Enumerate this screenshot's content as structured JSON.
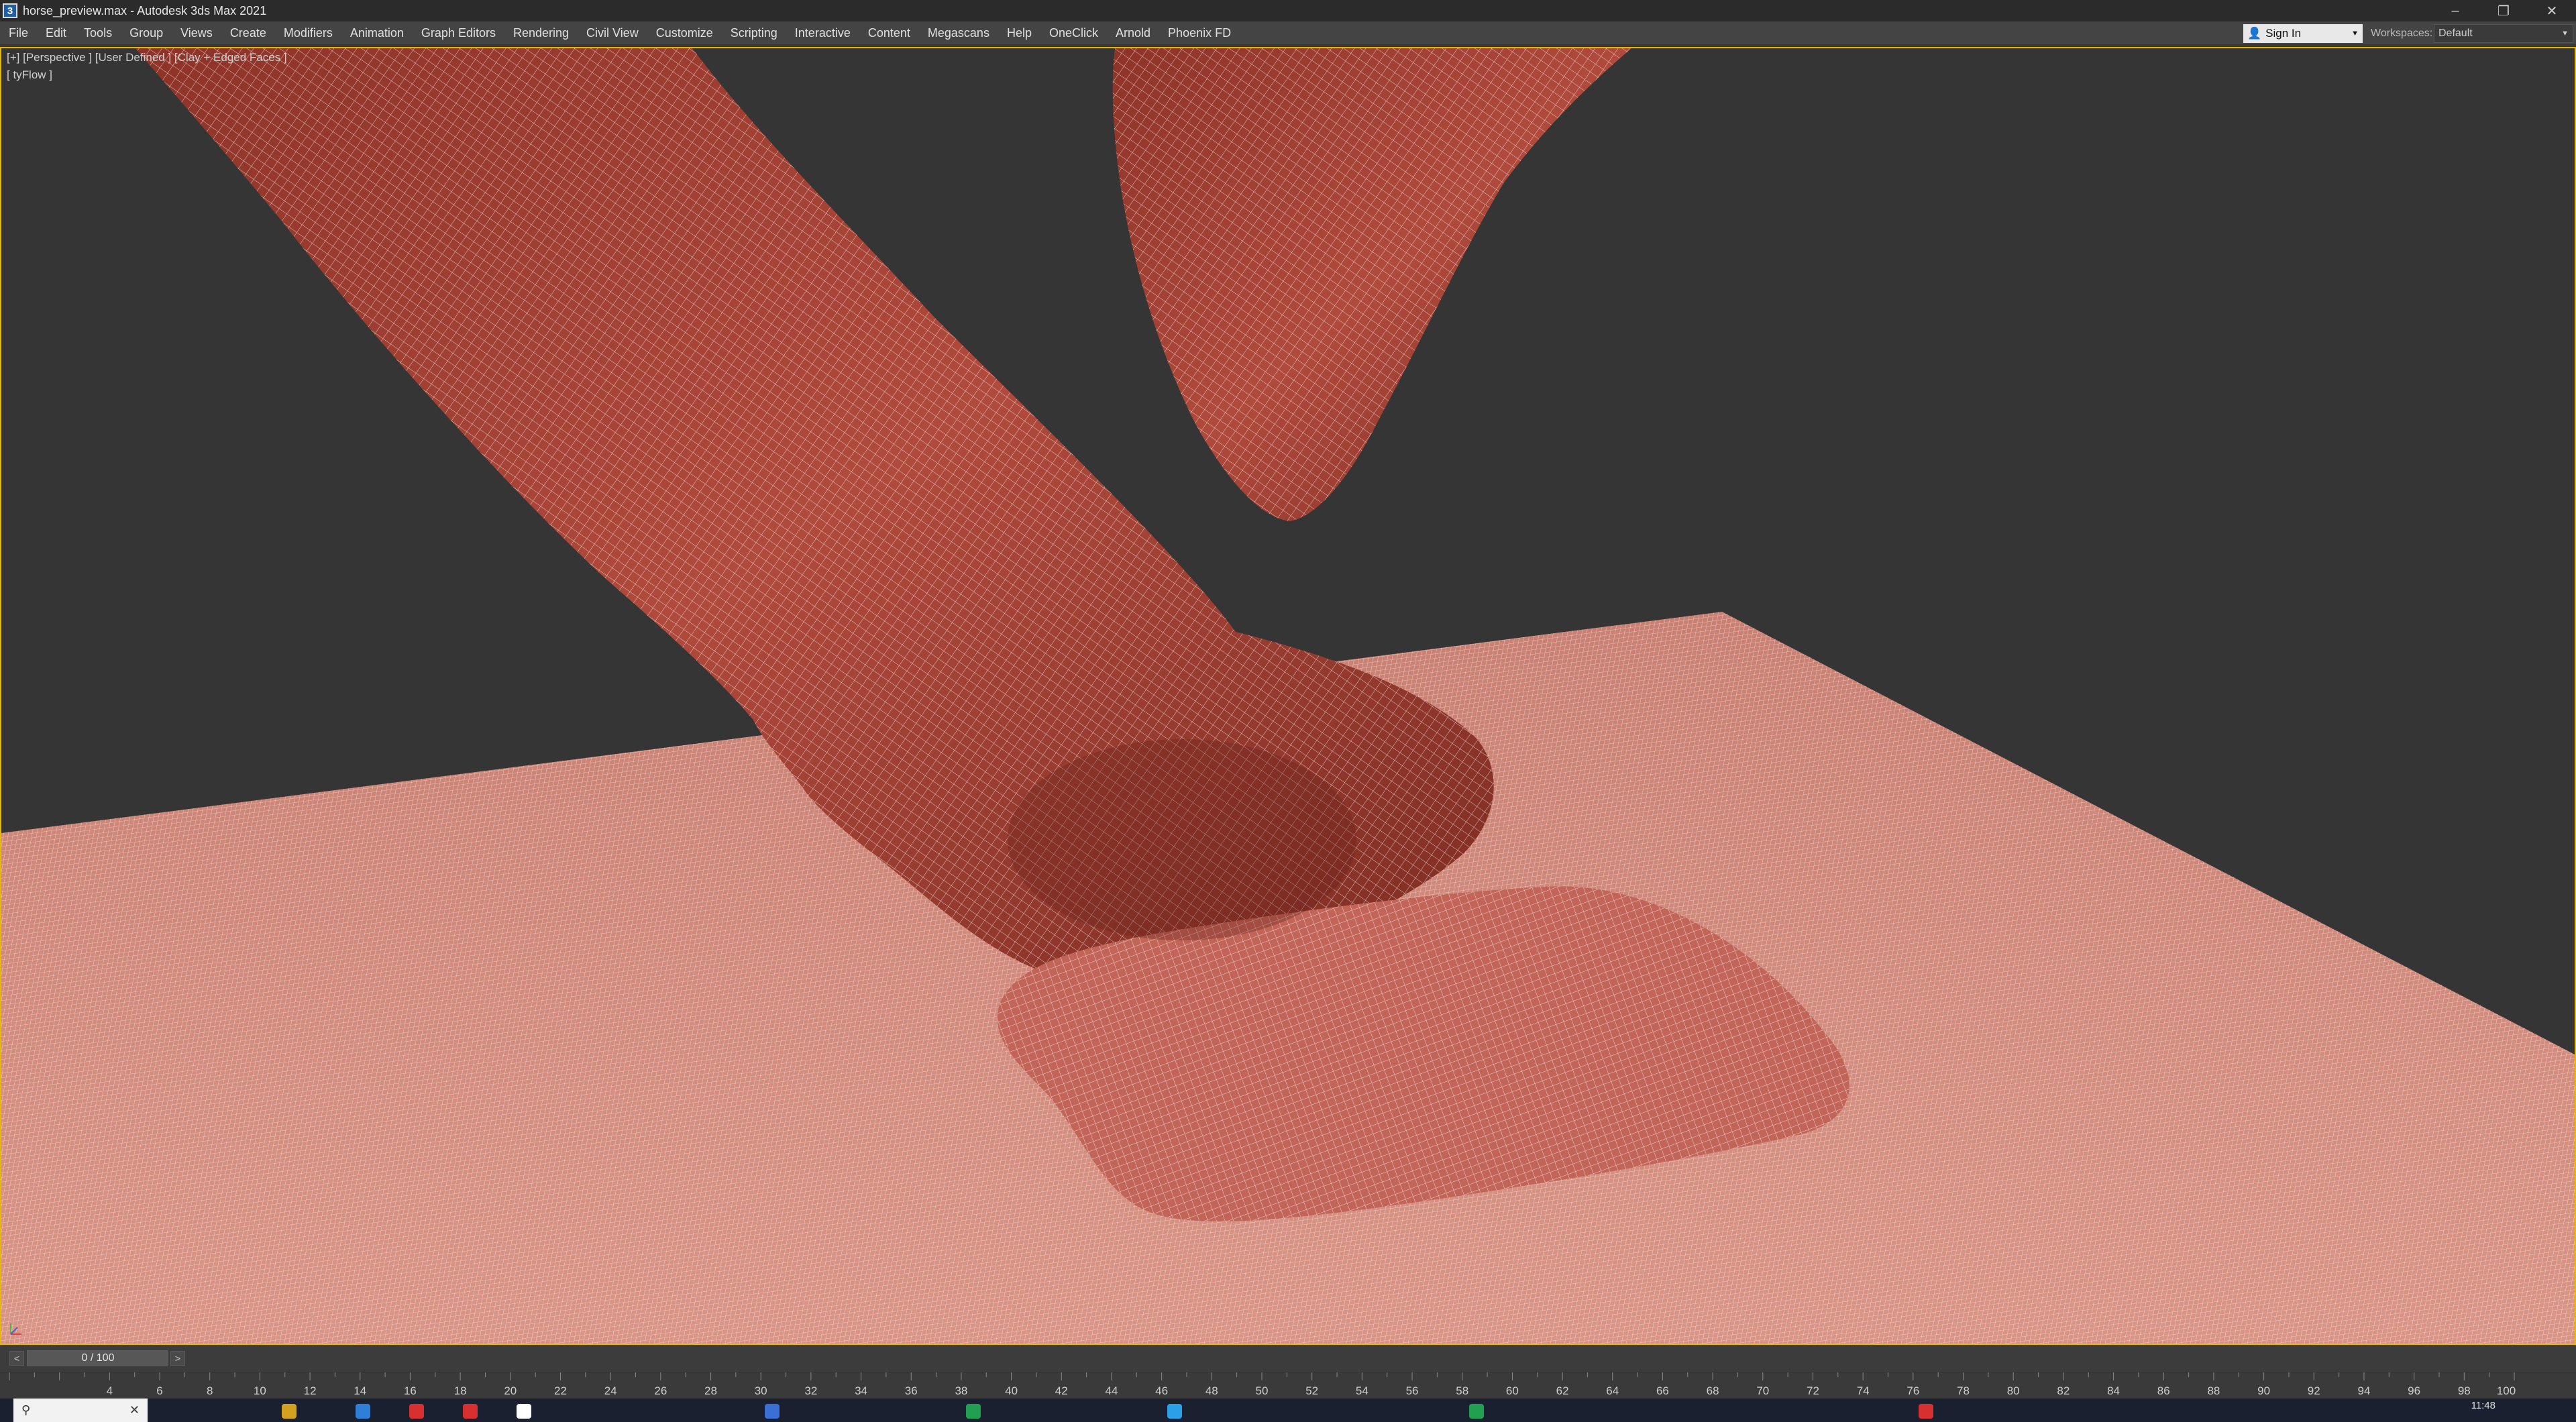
{
  "window": {
    "title": "horse_preview.max - Autodesk 3ds Max 2021",
    "icon": "3ds-max-app-icon",
    "controls": [
      "minimize-icon",
      "restore-icon",
      "close-icon"
    ]
  },
  "menu": {
    "items": [
      "File",
      "Edit",
      "Tools",
      "Group",
      "Views",
      "Create",
      "Modifiers",
      "Animation",
      "Graph Editors",
      "Rendering",
      "Civil View",
      "Customize",
      "Scripting",
      "Interactive",
      "Content",
      "Megascans",
      "Help",
      "OneClick",
      "Arnold",
      "Phoenix FD"
    ],
    "sign_in": "Sign In",
    "workspaces_label": "Workspaces:",
    "workspaces_value": "Default"
  },
  "viewport": {
    "label": "[+] [Perspective ] [User Defined ] [Clay + Edged Faces ]",
    "sublabel": "[ tyFlow ]",
    "border_color": "#e6b800",
    "mesh_color": "#b34a3c",
    "ground_color": "#d38a7c",
    "wire_color": "#ffffff"
  },
  "timeslider": {
    "prev": "<",
    "next": ">",
    "frame_display": "0 / 100"
  },
  "ruler": {
    "ticks": [
      "4",
      "6",
      "8",
      "10",
      "12",
      "14",
      "16",
      "18",
      "20",
      "22",
      "24",
      "26",
      "28",
      "30",
      "32",
      "34",
      "36",
      "38",
      "40",
      "42",
      "44",
      "46",
      "48",
      "50",
      "52",
      "54",
      "56",
      "58",
      "60",
      "62",
      "64",
      "66",
      "68",
      "70",
      "72",
      "74",
      "76",
      "78",
      "80",
      "82",
      "84",
      "86",
      "88",
      "90",
      "92",
      "94",
      "96",
      "98",
      "100"
    ]
  },
  "taskbar": {
    "clock": "11:48"
  }
}
